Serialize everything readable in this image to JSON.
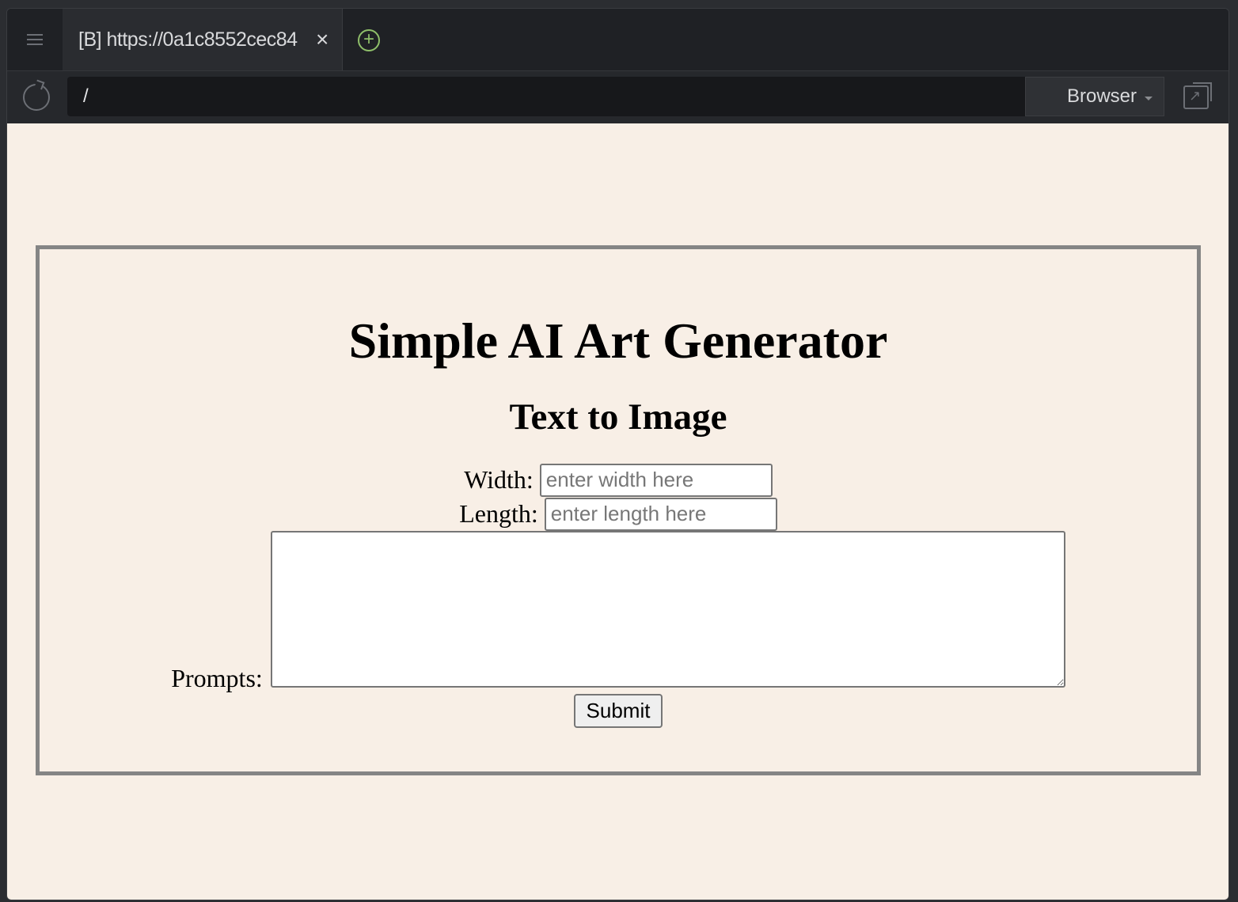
{
  "browser": {
    "tab_title": "[B] https://0a1c8552cec84",
    "tab_close": "×",
    "new_tab": "+",
    "address": "/",
    "mode": "Browser"
  },
  "page": {
    "title": "Simple AI Art Generator",
    "subtitle": "Text to Image",
    "width_label": "Width:",
    "width_placeholder": "enter width here",
    "length_label": "Length:",
    "length_placeholder": "enter length here",
    "prompts_label": "Prompts:",
    "submit_label": "Submit"
  },
  "colors": {
    "page_background": "#f8efe6",
    "card_border": "#858585",
    "new_tab_accent": "#8fbf6a"
  }
}
